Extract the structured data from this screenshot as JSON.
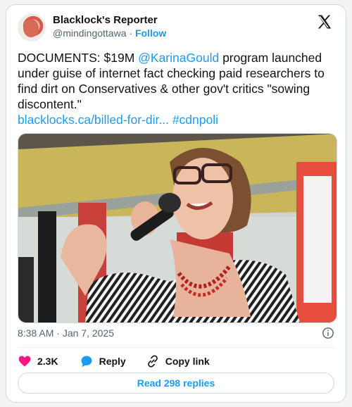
{
  "account": {
    "name": "Blacklock's Reporter",
    "handle": "@mindingottawa",
    "separator": "·",
    "follow_label": "Follow"
  },
  "tweet": {
    "text_before": "DOCUMENTS: $19M ",
    "mention": "@KarinaGould",
    "text_after": " program launched under guise of internet fact checking paid researchers to find dirt on Conservatives & other gov't critics \"sowing discontent.\"",
    "link": "blacklocks.ca/billed-for-dir...",
    "hashtag": "#cdnpoli"
  },
  "meta": {
    "time": "8:38 AM",
    "separator": "·",
    "date": "Jan 7, 2025"
  },
  "actions": {
    "likes": "2.3K",
    "reply_label": "Reply",
    "copy_label": "Copy link"
  },
  "replies_button": "Read 298 replies",
  "icons": {
    "brand": "x-logo-icon",
    "info": "info-icon",
    "like": "heart-icon",
    "reply": "reply-bubble-icon",
    "copy": "link-icon"
  },
  "colors": {
    "accent": "#1d9bf0",
    "like": "#f91880",
    "text": "#0f1419",
    "muted": "#536471",
    "border": "#cfd9de"
  }
}
